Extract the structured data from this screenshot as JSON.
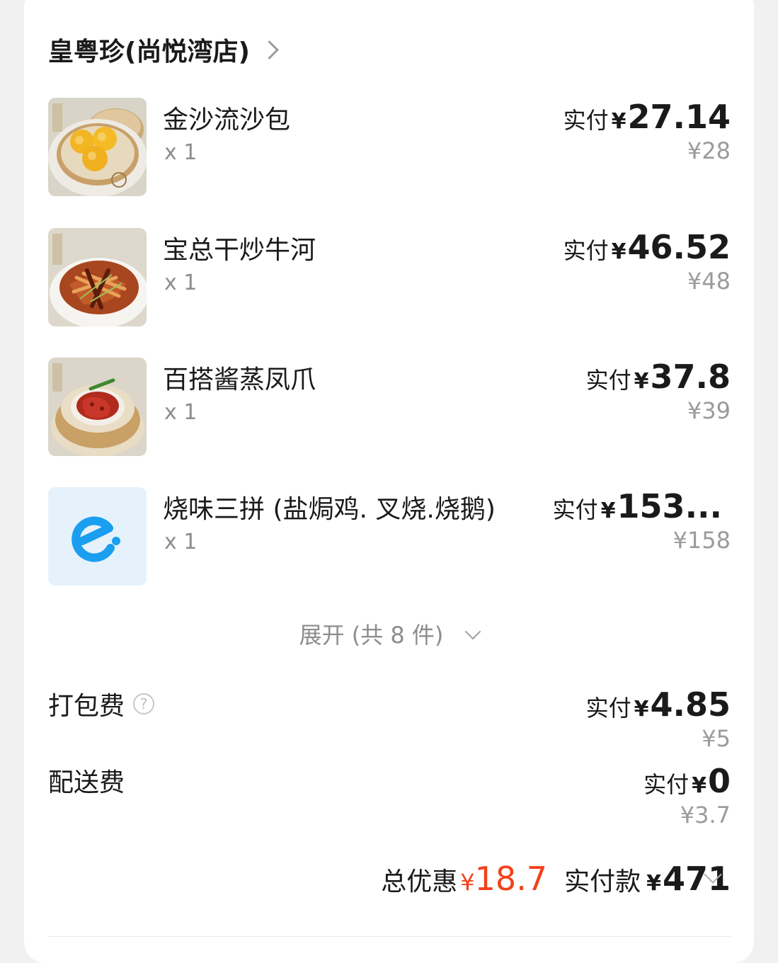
{
  "store": {
    "name": "皇粤珍(尚悦湾店)"
  },
  "items": [
    {
      "name": "金沙流沙包",
      "qty": "x 1",
      "pay_label": "实付",
      "currency": "¥",
      "pay_amount": "27.14",
      "original": "¥28",
      "image": "golden-buns-photo"
    },
    {
      "name": "宝总干炒牛河",
      "qty": "x 1",
      "pay_label": "实付",
      "currency": "¥",
      "pay_amount": "46.52",
      "original": "¥48",
      "image": "beef-noodles-photo"
    },
    {
      "name": "百搭酱蒸凤爪",
      "qty": "x 1",
      "pay_label": "实付",
      "currency": "¥",
      "pay_amount": "37.8",
      "original": "¥39",
      "image": "chicken-feet-photo"
    },
    {
      "name": "烧味三拼 (盐焗鸡. 叉烧.烧鹅)",
      "qty": "x 1",
      "pay_label": "实付",
      "currency": "¥",
      "pay_amount": "153...",
      "original": "¥158",
      "image": "eleme-logo-icon"
    }
  ],
  "expand": {
    "label": "展开 (共 8 件)"
  },
  "fees": [
    {
      "name": "打包费",
      "pay_label": "实付",
      "currency": "¥",
      "pay_amount": "4.85",
      "original": "¥5",
      "has_help": true
    },
    {
      "name": "配送费",
      "pay_label": "实付",
      "currency": "¥",
      "pay_amount": "0",
      "original": "¥3.7",
      "has_help": false
    }
  ],
  "summary": {
    "discount_label": "总优惠",
    "discount_currency": "¥",
    "discount_amount": "18.7",
    "paid_label": "实付款",
    "paid_currency": "¥",
    "paid_amount": "471"
  },
  "colors": {
    "accent_red": "#f2411a",
    "logo_blue": "#1a9ef0",
    "muted": "#9b9b9b"
  }
}
